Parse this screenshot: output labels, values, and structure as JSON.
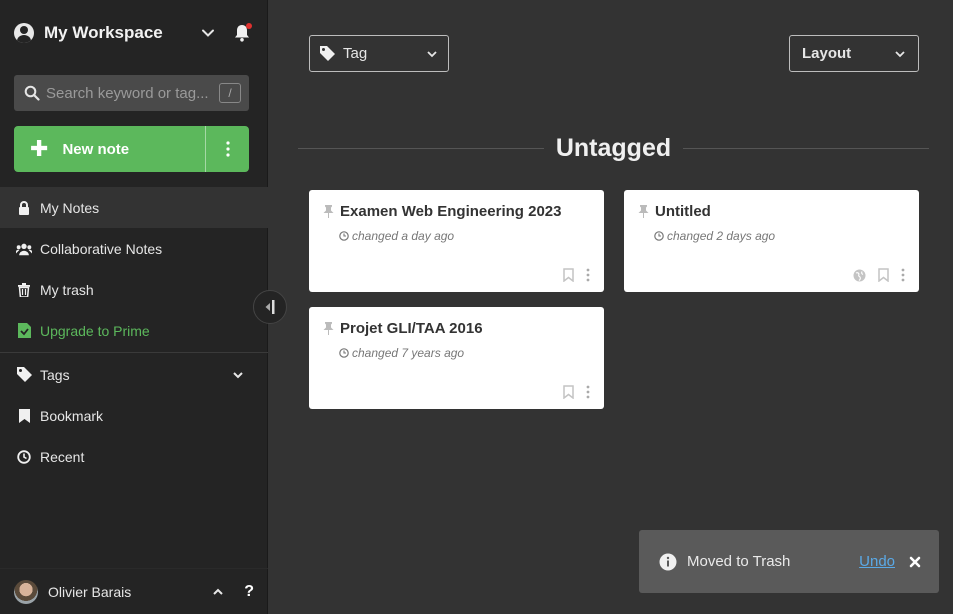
{
  "workspace": {
    "title": "My Workspace"
  },
  "search": {
    "placeholder": "Search keyword or tag...",
    "shortcut": "/"
  },
  "new_note": {
    "label": "New note"
  },
  "nav": {
    "my_notes": "My Notes",
    "collaborative": "Collaborative Notes",
    "trash": "My trash",
    "upgrade": "Upgrade to Prime",
    "tags": "Tags",
    "bookmark": "Bookmark",
    "recent": "Recent"
  },
  "user": {
    "name": "Olivier Barais",
    "help": "?"
  },
  "filters": {
    "tag_label": "Tag",
    "layout_label": "Layout"
  },
  "section": {
    "title": "Untagged"
  },
  "cards": [
    {
      "title": "Examen Web Engineering 2023",
      "time": "changed a day ago"
    },
    {
      "title": "Untitled",
      "time": "changed 2 days ago"
    },
    {
      "title": "Projet GLI/TAA 2016",
      "time": "changed 7 years ago"
    }
  ],
  "toast": {
    "message": "Moved to Trash",
    "undo": "Undo"
  },
  "colors": {
    "accent_green": "#5cb85c",
    "link_blue": "#5aa9e6",
    "notification_red": "#e0312f"
  },
  "icons": [
    "user-circle-icon",
    "chevron-down-icon",
    "bell-icon",
    "search-icon",
    "plus-icon",
    "kebab-icon",
    "lock-icon",
    "users-icon",
    "trash-icon",
    "prime-icon",
    "tag-icon",
    "bookmark-icon",
    "clock-icon",
    "chevron-up-icon",
    "pin-icon",
    "globe-icon",
    "info-icon",
    "close-icon"
  ]
}
